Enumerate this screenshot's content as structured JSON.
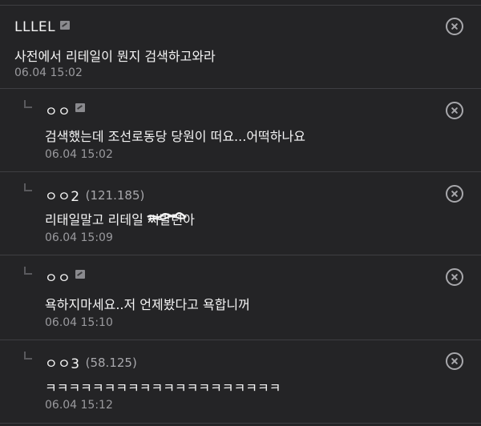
{
  "comments": [
    {
      "author": "LLLEL",
      "ip": "",
      "body": "사전에서 리테일이 뭔지 검색하고와라",
      "date": "06.04 15:02",
      "is_reply": false,
      "fixed_name_icon": true
    },
    {
      "author": "ㅇㅇ",
      "ip": "",
      "body": "검색했는데 조선로동당 당원이 떠요...어떡하나요",
      "date": "06.04 15:02",
      "is_reply": true,
      "fixed_name_icon": true
    },
    {
      "author": "ㅇㅇ2",
      "ip": "(121.185)",
      "body_before": "리태일말고 리테일 ",
      "body_scribbled": "씨발련",
      "body_after": "아",
      "date": "06.04 15:09",
      "is_reply": true,
      "fixed_name_icon": false
    },
    {
      "author": "ㅇㅇ",
      "ip": "",
      "body": "욕하지마세요..저 언제봤다고 욕합니꺼",
      "date": "06.04 15:10",
      "is_reply": true,
      "fixed_name_icon": true
    },
    {
      "author": "ㅇㅇ3",
      "ip": "(58.125)",
      "body": "ㅋㅋㅋㅋㅋㅋㅋㅋㅋㅋㅋㅋㅋㅋㅋㅋㅋㅋㅋㅋ",
      "date": "06.04 15:12",
      "is_reply": true,
      "fixed_name_icon": false
    }
  ],
  "icons": {
    "delete": "close-circle-icon",
    "reply": "reply-arrow-icon",
    "fixed_name": "fixed-nickname-icon"
  },
  "colors": {
    "background": "#242426",
    "divider": "#3e3e42",
    "text": "#f5f5f5",
    "meta": "#9a9a9e"
  }
}
